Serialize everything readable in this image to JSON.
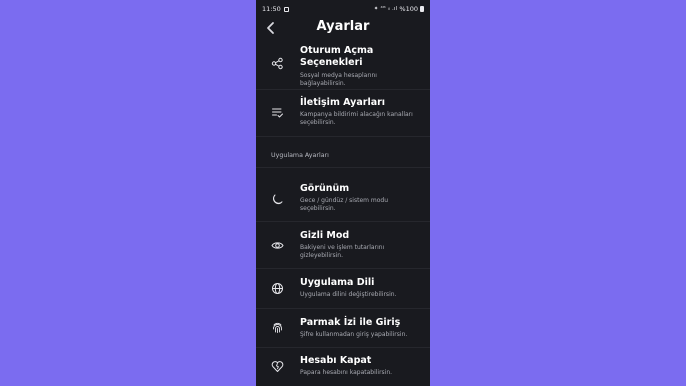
{
  "status": {
    "time": "11:50",
    "right_icons": "✦ ⁴ᴳ ᵢₗ .ıl",
    "battery": "%100"
  },
  "header": {
    "title": "Ayarlar"
  },
  "items": [
    {
      "title": "Oturum Açma Seçenekleri",
      "desc": "Sosyal medya hesaplarını bağlayabilirsin.",
      "icon": "share-icon"
    },
    {
      "title": "İletişim Ayarları",
      "desc": "Kampanya bildirimi alacağın kanalları seçebilirsin.",
      "icon": "list-check-icon"
    },
    {
      "title": "Görünüm",
      "desc": "Gece / gündüz / sistem modu seçebilirsin.",
      "icon": "moon-icon"
    },
    {
      "title": "Gizli Mod",
      "desc": "Bakiyeni ve işlem tutarlarını gizleyebilirsin.",
      "icon": "eye-icon"
    },
    {
      "title": "Uygulama Dili",
      "desc": "Uygulama dilini değiştirebilirsin.",
      "icon": "globe-icon"
    },
    {
      "title": "Parmak İzi ile Giriş",
      "desc": "Şifre kullanmadan giriş yapabilirsin.",
      "icon": "fingerprint-icon"
    },
    {
      "title": "Hesabı Kapat",
      "desc": "Papara hesabını kapatabilirsin.",
      "icon": "heart-broken-icon"
    }
  ],
  "section_label": "Uygulama Ayarları"
}
